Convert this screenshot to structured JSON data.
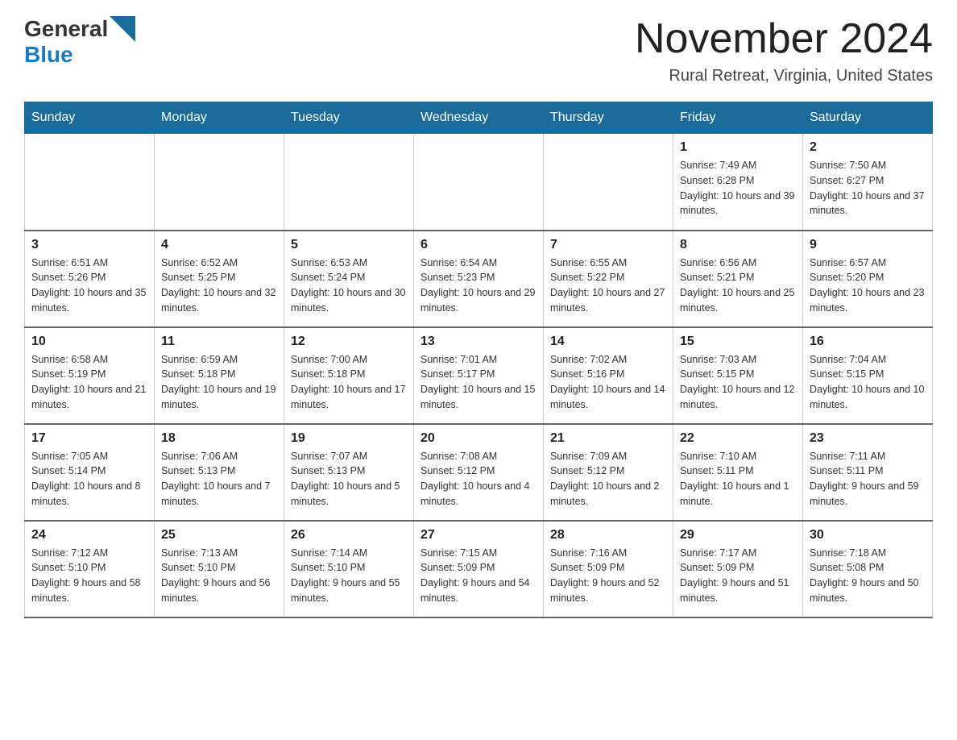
{
  "header": {
    "logo_general": "General",
    "logo_blue": "Blue",
    "month_title": "November 2024",
    "location": "Rural Retreat, Virginia, United States"
  },
  "days_of_week": [
    "Sunday",
    "Monday",
    "Tuesday",
    "Wednesday",
    "Thursday",
    "Friday",
    "Saturday"
  ],
  "weeks": [
    [
      {
        "day": "",
        "info": ""
      },
      {
        "day": "",
        "info": ""
      },
      {
        "day": "",
        "info": ""
      },
      {
        "day": "",
        "info": ""
      },
      {
        "day": "",
        "info": ""
      },
      {
        "day": "1",
        "info": "Sunrise: 7:49 AM\nSunset: 6:28 PM\nDaylight: 10 hours and 39 minutes."
      },
      {
        "day": "2",
        "info": "Sunrise: 7:50 AM\nSunset: 6:27 PM\nDaylight: 10 hours and 37 minutes."
      }
    ],
    [
      {
        "day": "3",
        "info": "Sunrise: 6:51 AM\nSunset: 5:26 PM\nDaylight: 10 hours and 35 minutes."
      },
      {
        "day": "4",
        "info": "Sunrise: 6:52 AM\nSunset: 5:25 PM\nDaylight: 10 hours and 32 minutes."
      },
      {
        "day": "5",
        "info": "Sunrise: 6:53 AM\nSunset: 5:24 PM\nDaylight: 10 hours and 30 minutes."
      },
      {
        "day": "6",
        "info": "Sunrise: 6:54 AM\nSunset: 5:23 PM\nDaylight: 10 hours and 29 minutes."
      },
      {
        "day": "7",
        "info": "Sunrise: 6:55 AM\nSunset: 5:22 PM\nDaylight: 10 hours and 27 minutes."
      },
      {
        "day": "8",
        "info": "Sunrise: 6:56 AM\nSunset: 5:21 PM\nDaylight: 10 hours and 25 minutes."
      },
      {
        "day": "9",
        "info": "Sunrise: 6:57 AM\nSunset: 5:20 PM\nDaylight: 10 hours and 23 minutes."
      }
    ],
    [
      {
        "day": "10",
        "info": "Sunrise: 6:58 AM\nSunset: 5:19 PM\nDaylight: 10 hours and 21 minutes."
      },
      {
        "day": "11",
        "info": "Sunrise: 6:59 AM\nSunset: 5:18 PM\nDaylight: 10 hours and 19 minutes."
      },
      {
        "day": "12",
        "info": "Sunrise: 7:00 AM\nSunset: 5:18 PM\nDaylight: 10 hours and 17 minutes."
      },
      {
        "day": "13",
        "info": "Sunrise: 7:01 AM\nSunset: 5:17 PM\nDaylight: 10 hours and 15 minutes."
      },
      {
        "day": "14",
        "info": "Sunrise: 7:02 AM\nSunset: 5:16 PM\nDaylight: 10 hours and 14 minutes."
      },
      {
        "day": "15",
        "info": "Sunrise: 7:03 AM\nSunset: 5:15 PM\nDaylight: 10 hours and 12 minutes."
      },
      {
        "day": "16",
        "info": "Sunrise: 7:04 AM\nSunset: 5:15 PM\nDaylight: 10 hours and 10 minutes."
      }
    ],
    [
      {
        "day": "17",
        "info": "Sunrise: 7:05 AM\nSunset: 5:14 PM\nDaylight: 10 hours and 8 minutes."
      },
      {
        "day": "18",
        "info": "Sunrise: 7:06 AM\nSunset: 5:13 PM\nDaylight: 10 hours and 7 minutes."
      },
      {
        "day": "19",
        "info": "Sunrise: 7:07 AM\nSunset: 5:13 PM\nDaylight: 10 hours and 5 minutes."
      },
      {
        "day": "20",
        "info": "Sunrise: 7:08 AM\nSunset: 5:12 PM\nDaylight: 10 hours and 4 minutes."
      },
      {
        "day": "21",
        "info": "Sunrise: 7:09 AM\nSunset: 5:12 PM\nDaylight: 10 hours and 2 minutes."
      },
      {
        "day": "22",
        "info": "Sunrise: 7:10 AM\nSunset: 5:11 PM\nDaylight: 10 hours and 1 minute."
      },
      {
        "day": "23",
        "info": "Sunrise: 7:11 AM\nSunset: 5:11 PM\nDaylight: 9 hours and 59 minutes."
      }
    ],
    [
      {
        "day": "24",
        "info": "Sunrise: 7:12 AM\nSunset: 5:10 PM\nDaylight: 9 hours and 58 minutes."
      },
      {
        "day": "25",
        "info": "Sunrise: 7:13 AM\nSunset: 5:10 PM\nDaylight: 9 hours and 56 minutes."
      },
      {
        "day": "26",
        "info": "Sunrise: 7:14 AM\nSunset: 5:10 PM\nDaylight: 9 hours and 55 minutes."
      },
      {
        "day": "27",
        "info": "Sunrise: 7:15 AM\nSunset: 5:09 PM\nDaylight: 9 hours and 54 minutes."
      },
      {
        "day": "28",
        "info": "Sunrise: 7:16 AM\nSunset: 5:09 PM\nDaylight: 9 hours and 52 minutes."
      },
      {
        "day": "29",
        "info": "Sunrise: 7:17 AM\nSunset: 5:09 PM\nDaylight: 9 hours and 51 minutes."
      },
      {
        "day": "30",
        "info": "Sunrise: 7:18 AM\nSunset: 5:08 PM\nDaylight: 9 hours and 50 minutes."
      }
    ]
  ]
}
